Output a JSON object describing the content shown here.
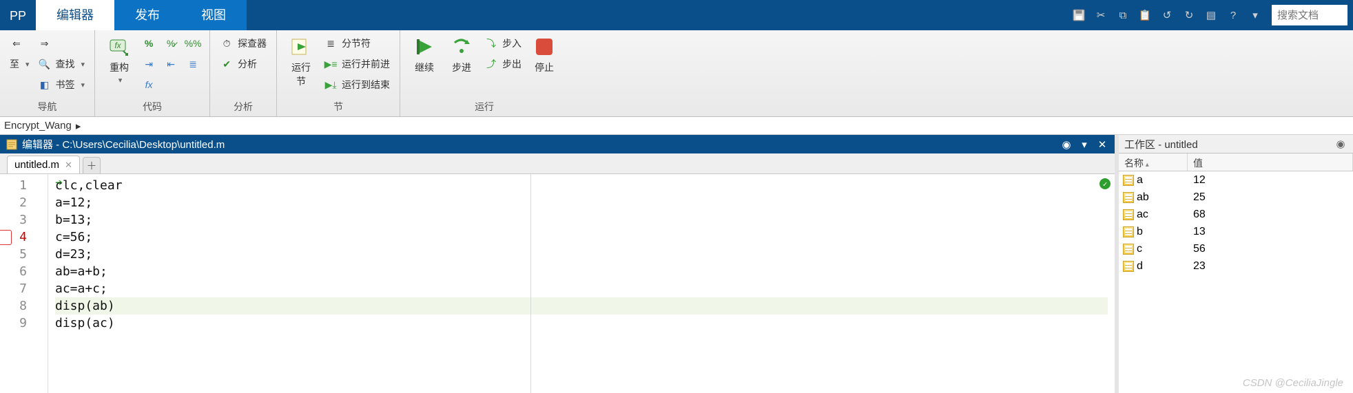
{
  "tabs": {
    "app": "PP",
    "editor": "编辑器",
    "publish": "发布",
    "view": "视图"
  },
  "qat": {
    "search_placeholder": "搜索文档"
  },
  "ribbon": {
    "nav": {
      "label": "导航",
      "goto": "至",
      "find": "查找",
      "bookmark": "书签"
    },
    "code": {
      "label": "代码",
      "refactor": "重构"
    },
    "analyze": {
      "label": "分析",
      "profiler": "探查器",
      "analyze": "分析"
    },
    "section": {
      "label": "节",
      "run_section": "运行\n节",
      "section_break": "分节符",
      "run_advance": "运行并前进",
      "run_to_end": "运行到结束"
    },
    "run": {
      "label": "运行",
      "continue": "继续",
      "step": "步进",
      "step_in": "步入",
      "step_out": "步出",
      "stop": "停止"
    }
  },
  "breadcrumb": {
    "seg1": "Encrypt_Wang"
  },
  "editor": {
    "title": "编辑器 - C:\\Users\\Cecilia\\Desktop\\untitled.m",
    "tabname": "untitled.m",
    "lines": [
      "clc,clear",
      "a=12;",
      "b=13;",
      "c=56;",
      "d=23;",
      "ab=a+b;",
      "ac=a+c;",
      "disp(ab)",
      "disp(ac)"
    ],
    "breakpoint_line": 4,
    "current_line": 8
  },
  "workspace": {
    "title": "工作区 - untitled",
    "col_name": "名称",
    "col_value": "值",
    "vars": [
      {
        "name": "a",
        "value": "12"
      },
      {
        "name": "ab",
        "value": "25"
      },
      {
        "name": "ac",
        "value": "68"
      },
      {
        "name": "b",
        "value": "13"
      },
      {
        "name": "c",
        "value": "56"
      },
      {
        "name": "d",
        "value": "23"
      }
    ]
  },
  "watermark": "CSDN @CeciliaJingle"
}
